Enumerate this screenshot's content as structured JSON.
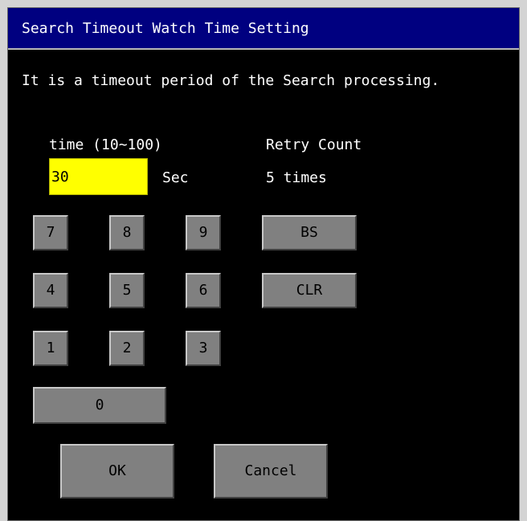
{
  "window": {
    "title": "Search Timeout Watch Time Setting"
  },
  "description": "It is a timeout period of the Search processing.",
  "time": {
    "label": "time (10~100)",
    "value": "30",
    "unit": "Sec"
  },
  "retry": {
    "label": "Retry Count",
    "value": "5 times"
  },
  "keypad": {
    "k7": "7",
    "k8": "8",
    "k9": "9",
    "bs": "BS",
    "k4": "4",
    "k5": "5",
    "k6": "6",
    "clr": "CLR",
    "k1": "1",
    "k2": "2",
    "k3": "3",
    "k0": "0"
  },
  "buttons": {
    "ok": "OK",
    "cancel": "Cancel"
  },
  "colors": {
    "title_bar": "#000080",
    "background": "#000000",
    "input_bg": "#ffff00",
    "key_bg": "#808080"
  }
}
